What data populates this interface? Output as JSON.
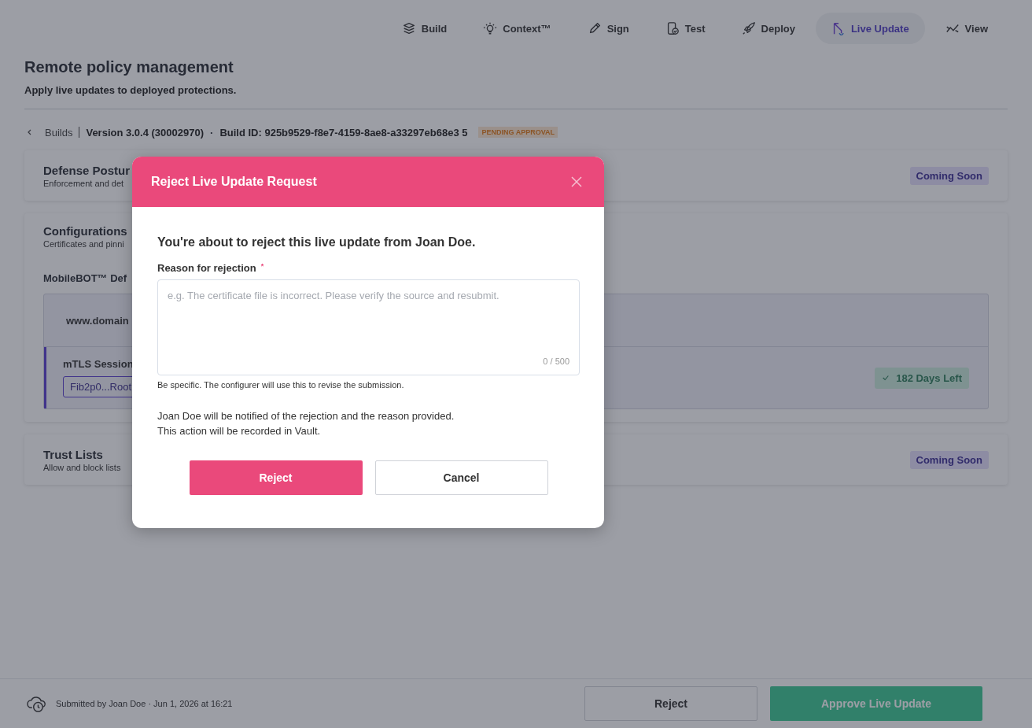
{
  "nav": {
    "tabs": [
      {
        "label": "Build",
        "selected": false
      },
      {
        "label": "Context™",
        "selected": false
      },
      {
        "label": "Sign",
        "selected": false
      },
      {
        "label": "Test",
        "selected": false
      },
      {
        "label": "Deploy",
        "selected": false
      },
      {
        "label": "Live Update",
        "selected": true
      },
      {
        "label": "View",
        "selected": false
      }
    ]
  },
  "header": {
    "title": "Remote policy management",
    "subtitle": "Apply live updates to deployed protections."
  },
  "breadcrumb": {
    "back": "Builds",
    "version": "Version 3.0.4 (30002970)",
    "separator": "·",
    "build_id": "Build ID: 925b9529-f8e7-4159-8ae8-a33297eb68e3 5",
    "status": "PENDING APPROVAL"
  },
  "sections": [
    {
      "kind": "simple",
      "title": "Defense Postur",
      "subtitle": "Enforcement and det",
      "badge": "Coming Soon"
    },
    {
      "kind": "config",
      "title": "Configurations",
      "subtitle": "Certificates and pinni",
      "group_title": "MobileBOT™ Def",
      "domain": "www.domain",
      "session_title": "mTLS Session",
      "chip": "Fib2p0...Root",
      "expiry": "182 Days Left"
    },
    {
      "kind": "simple",
      "title": "Trust Lists",
      "subtitle": "Allow and block lists",
      "badge": "Coming Soon"
    }
  ],
  "footer": {
    "submitted": "Submitted by Joan Doe · Jun 1, 2026 at 16:21",
    "reject": "Reject",
    "approve": "Approve Live Update"
  },
  "dialog": {
    "title": "Reject Live Update Request",
    "lead": "You're about to reject this live update from Joan Doe.",
    "field_label": "Reason for rejection",
    "required_mark": "*",
    "placeholder": "e.g. The certificate file is incorrect. Please verify the source and resubmit.",
    "counter": "0 / 500",
    "hint": "Be specific. The configurer will use this to revise the submission.",
    "notice_lines": [
      "Joan Doe will be notified of the rejection and the reason provided.",
      "This action will be recorded in Vault."
    ],
    "confirm": "Reject",
    "cancel": "Cancel"
  }
}
